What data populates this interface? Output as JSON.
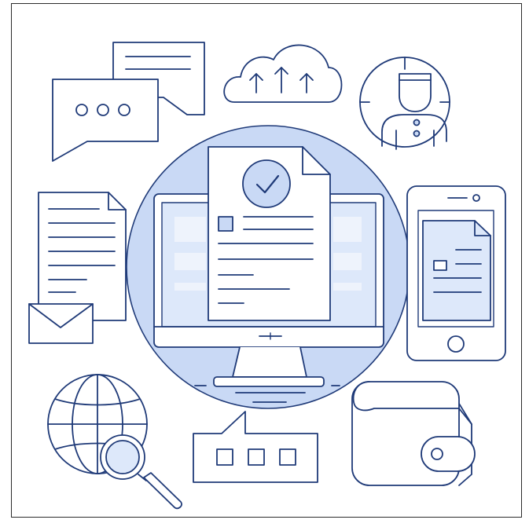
{
  "illustration": {
    "colors": {
      "stroke": "#1f3a78",
      "fill_light": "#c9d9f5",
      "fill_lighter": "#dde8fa",
      "paper": "#ffffff",
      "frame": "#2b2b2b"
    },
    "icons": [
      "chat-bubbles-icon",
      "cloud-upload-icon",
      "user-target-icon",
      "document-list-icon",
      "envelope-icon",
      "monitor-icon",
      "approved-document-icon",
      "checkmark-icon",
      "smartphone-icon",
      "globe-icon",
      "magnifier-icon",
      "message-box-icon",
      "wallet-icon"
    ]
  }
}
